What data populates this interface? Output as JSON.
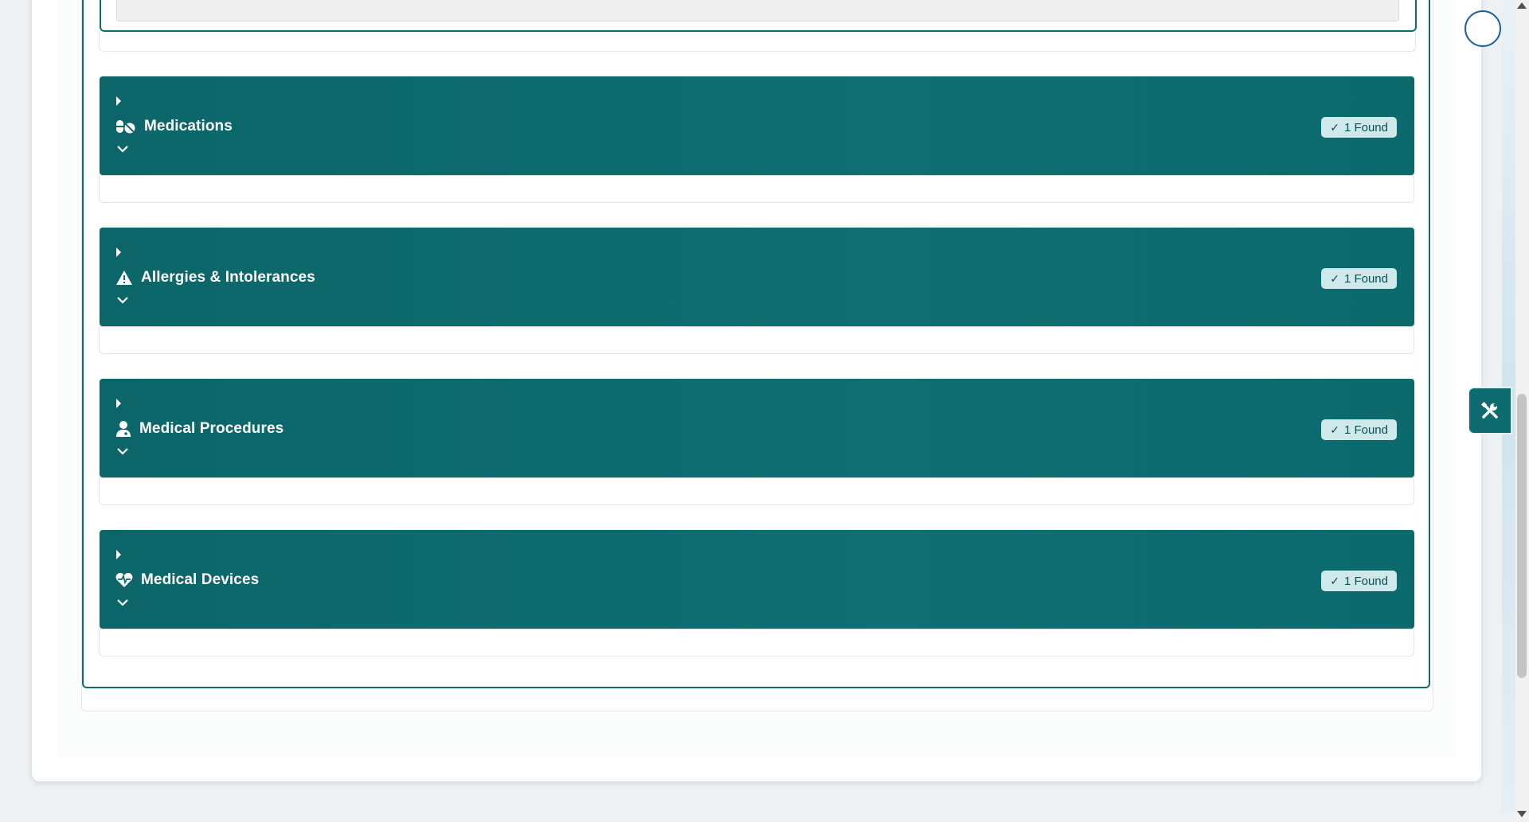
{
  "sections": [
    {
      "title": "Medications",
      "icon": "pills-icon",
      "badge": "1 Found"
    },
    {
      "title": "Allergies & Intolerances",
      "icon": "warning-triangle-icon",
      "badge": "1 Found"
    },
    {
      "title": "Medical Procedures",
      "icon": "doctor-icon",
      "badge": "1 Found"
    },
    {
      "title": "Medical Devices",
      "icon": "heart-pulse-icon",
      "badge": "1 Found"
    }
  ],
  "badge_check": "✓",
  "colors": {
    "accent": "#0e6b6f",
    "badge_bg": "#cfe9ea",
    "badge_text": "#0b4f52"
  }
}
